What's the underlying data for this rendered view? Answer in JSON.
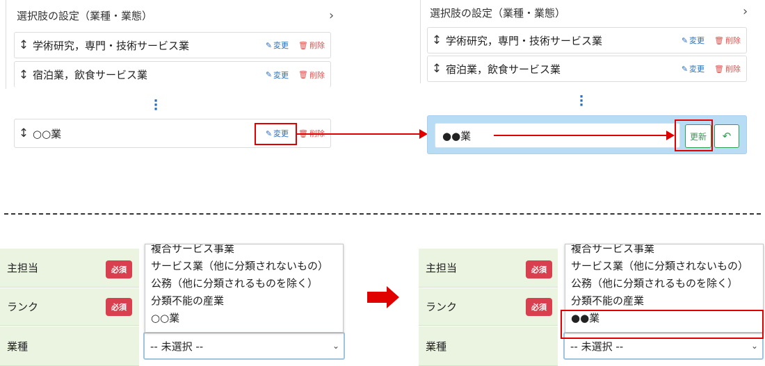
{
  "top_left": {
    "panel_title": "選択肢の設定（業種・業態）",
    "items": [
      {
        "label": "学術研究，専門・技術サービス業"
      },
      {
        "label": "宿泊業，飲食サービス業"
      },
      {
        "label": "○○業"
      }
    ],
    "edit_label": "変更",
    "delete_label": "削除"
  },
  "top_right": {
    "panel_title": "選択肢の設定（業種・業態）",
    "items": [
      {
        "label": "学術研究，専門・技術サービス業"
      },
      {
        "label": "宿泊業，飲食サービス業"
      }
    ],
    "edit_label": "変更",
    "delete_label": "削除",
    "input_value": "●●業",
    "update_label": "更新"
  },
  "form_left": {
    "rows": [
      {
        "label": "主担当",
        "badge": "必須"
      },
      {
        "label": "ランク",
        "badge": "必須"
      },
      {
        "label": "業種"
      }
    ],
    "options": [
      "複合サービス事業",
      "サービス業（他に分類されないもの）",
      "公務（他に分類されるものを除く）",
      "分類不能の産業",
      "○○業"
    ],
    "select_value": "-- 未選択 --"
  },
  "form_right": {
    "rows": [
      {
        "label": "主担当",
        "badge": "必須"
      },
      {
        "label": "ランク",
        "badge": "必須"
      },
      {
        "label": "業種"
      }
    ],
    "options": [
      "複合サービス事業",
      "サービス業（他に分類されないもの）",
      "公務（他に分類されるものを除く）",
      "分類不能の産業",
      "●●業"
    ],
    "select_value": "-- 未選択 --"
  },
  "colors": {
    "highlight": "#e00000",
    "edit_bg": "#b9dcf5",
    "accent_blue": "#2a6ebb",
    "success": "#2e9f4f",
    "danger": "#d9404f",
    "form_label_bg": "#eaf4e1"
  },
  "icons": [
    "sort-arrows-icon",
    "edit-icon",
    "trash-icon",
    "vertical-ellipsis-icon",
    "chevron-right-icon",
    "undo-icon",
    "chevron-down-icon"
  ]
}
